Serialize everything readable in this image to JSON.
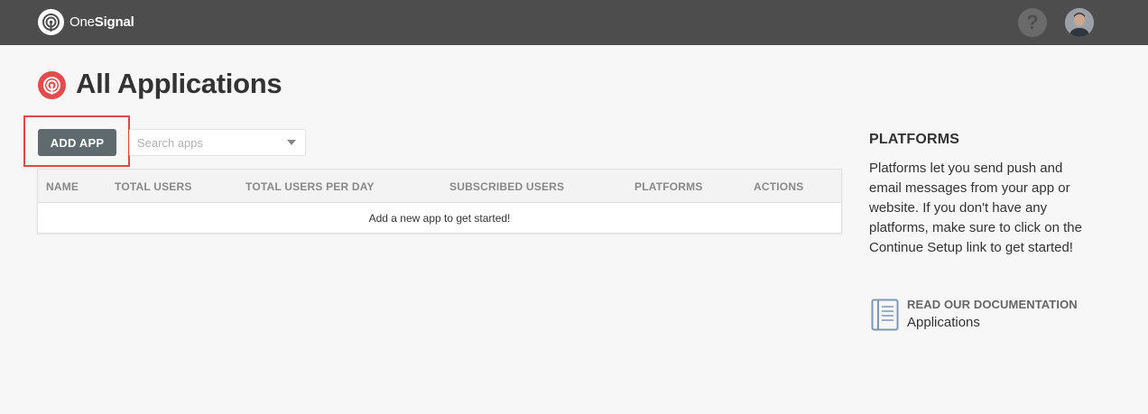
{
  "header": {
    "brand_light": "One",
    "brand_bold": "Signal",
    "help_label": "?",
    "bg_color": "#4d4d4d"
  },
  "page": {
    "title": "All Applications",
    "title_icon": "onesignal-logo-icon",
    "accent_color": "#e54b4d"
  },
  "toolbar": {
    "add_label": "ADD APP",
    "search_placeholder": "Search apps"
  },
  "table": {
    "columns": [
      "NAME",
      "TOTAL USERS",
      "TOTAL USERS PER DAY",
      "SUBSCRIBED USERS",
      "PLATFORMS",
      "ACTIONS"
    ],
    "empty_message": "Add a new app to get started!"
  },
  "sidebar": {
    "title": "PLATFORMS",
    "description": "Platforms let you send push and email messages from your app or website. If you don't have any platforms, make sure to click on the Continue Setup link to get started!",
    "doc_label": "READ OUR DOCUMENTATION",
    "doc_link": "Applications",
    "doc_icon": "document-icon"
  }
}
